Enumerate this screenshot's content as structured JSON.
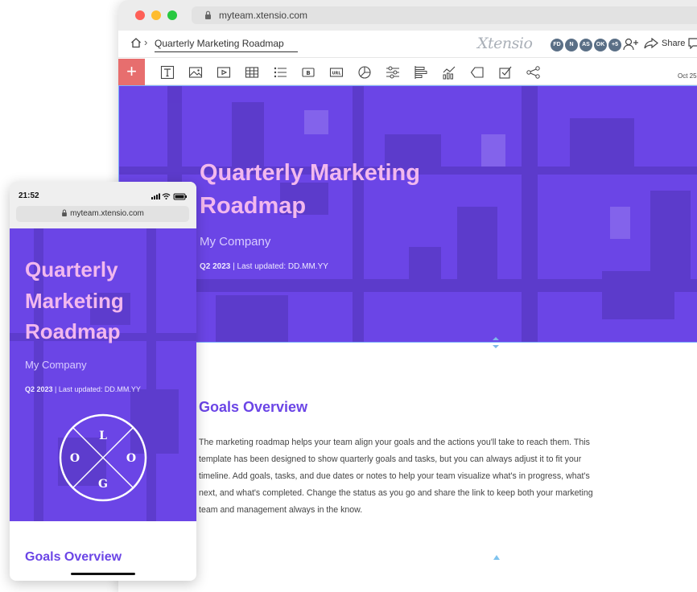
{
  "browser": {
    "url": "myteam.xtensio.com",
    "doc_title": "Quarterly Marketing Roadmap",
    "brand": "Xtensio",
    "avatars": [
      "FD",
      "N",
      "AS",
      "OK",
      "+5"
    ],
    "share_label": "Share",
    "date": "Oct 25"
  },
  "toolbar": {
    "tools": [
      "text-tool-icon",
      "image-tool-icon",
      "video-tool-icon",
      "table-tool-icon",
      "list-tool-icon",
      "button-tool-icon",
      "url-tool-icon",
      "pie-chart-tool-icon",
      "slider-tool-icon",
      "bar-graph-tool-icon",
      "line-chart-tool-icon",
      "tag-tool-icon",
      "checklist-tool-icon",
      "share-tool-icon"
    ]
  },
  "hero": {
    "title": "Quarterly Marketing Roadmap",
    "company": "My Company",
    "quarter": "Q2 2023",
    "updated": " | Last updated: DD.MM.YY"
  },
  "goals": {
    "title": "Goals Overview",
    "body": "The marketing roadmap helps your team align your goals and the actions you'll take to reach them. This template has been designed to show quarterly goals and tasks, but you can always adjust it to fit your timeline. Add goals, tasks, and due dates or notes to help your team visualize what's in progress, what's next, and what's completed. Change the status as you go and share the link to keep both your marketing team and management always in the know."
  },
  "mobile": {
    "time": "21:52",
    "url": "myteam.xtensio.com",
    "title": "Quarterly Marketing Roadmap",
    "company": "My Company",
    "quarter": "Q2 2023",
    "updated": " | Last updated: DD.MM.YY",
    "logo_letters": [
      "L",
      "O",
      "G",
      "O"
    ],
    "goals_title": "Goals Overview"
  },
  "colors": {
    "hero_bg": "#6b45e6",
    "title_pink": "#f2b8ee",
    "plus_red": "#e76e6e"
  }
}
